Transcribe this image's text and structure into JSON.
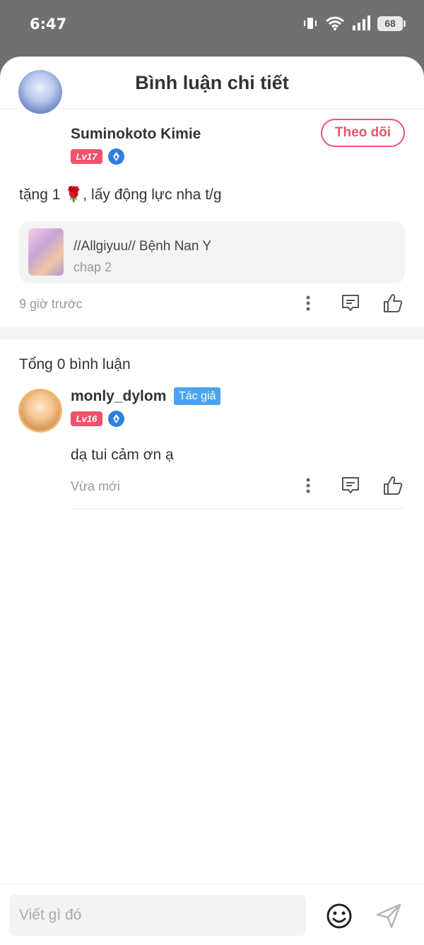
{
  "status_bar": {
    "time": "6:47",
    "battery": "68"
  },
  "header": {
    "title": "Bình luận chi tiết"
  },
  "post": {
    "username": "Suminokoto Kimie",
    "level": "Lv17",
    "follow_label": "Theo dõi",
    "text": "tặng 1 🌹, lấy động lực nha t/g",
    "chapter_card": {
      "title": "//Allgiyuu// Bệnh Nan Y",
      "subtitle": "chap 2"
    },
    "time": "9 giờ trước"
  },
  "comments_total": "Tổng 0 bình luận",
  "reply": {
    "username": "monly_dylom",
    "author_tag": "Tác giả",
    "level": "Lv16",
    "text": "dạ tui cảm ơn ạ",
    "time": "Vừa mới"
  },
  "composer": {
    "placeholder": "Viết gì đó"
  },
  "colors": {
    "accent": "#e8566c",
    "level_badge": "#f0516b",
    "author_tag": "#4aa3f0",
    "gem": "#2f7ee0"
  }
}
